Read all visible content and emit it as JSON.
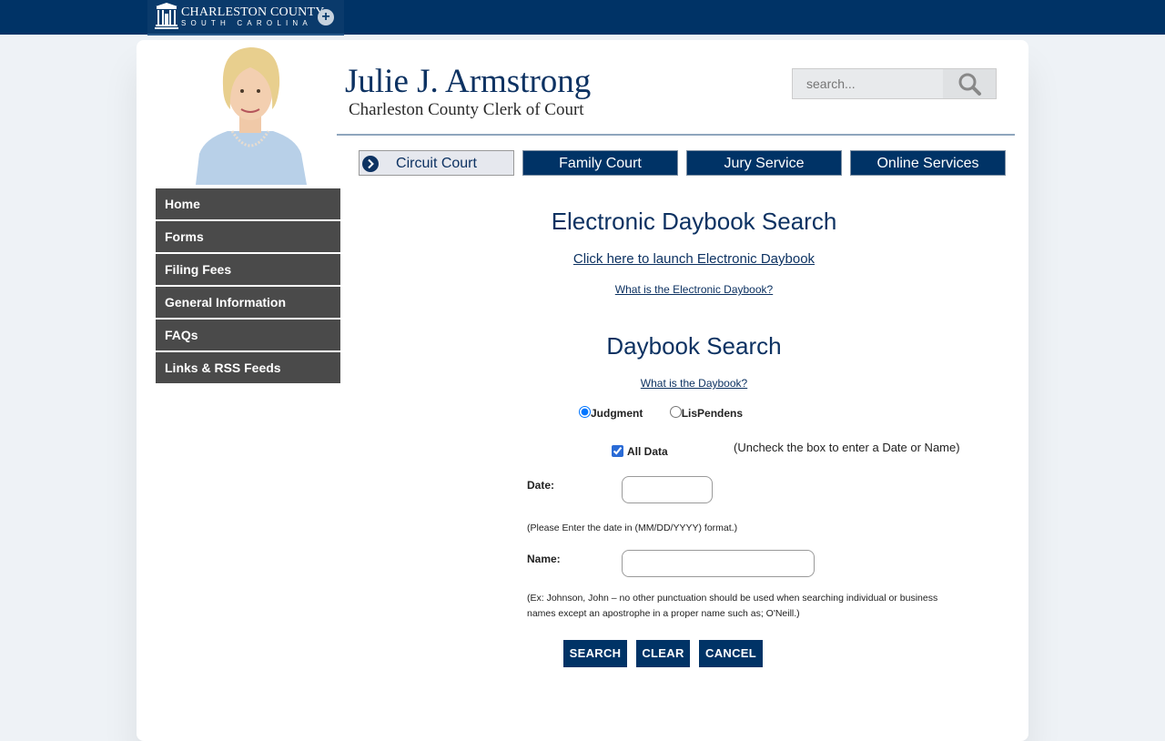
{
  "header": {
    "logo_line1": "CHARLESTON COUNTY",
    "logo_line2": "SOUTH CAROLINA",
    "logo_plus": "+"
  },
  "site": {
    "name": "Julie J. Armstrong",
    "subtitle": "Charleston County Clerk of Court"
  },
  "search": {
    "placeholder": "search..."
  },
  "topnav": [
    {
      "label": "Circuit Court",
      "active": true
    },
    {
      "label": "Family Court",
      "active": false
    },
    {
      "label": "Jury Service",
      "active": false
    },
    {
      "label": "Online Services",
      "active": false
    }
  ],
  "sidebar": {
    "items": [
      {
        "label": "Home"
      },
      {
        "label": "Forms"
      },
      {
        "label": "Filing Fees"
      },
      {
        "label": "General Information"
      },
      {
        "label": "FAQs"
      },
      {
        "label": "Links & RSS Feeds"
      }
    ]
  },
  "main": {
    "ed_heading": "Electronic Daybook Search",
    "ed_launch_link": "Click here to launch Electronic Daybook",
    "ed_what_link": "What is the Electronic Daybook?",
    "db_heading": "Daybook Search",
    "db_what_link": "What is the Daybook?",
    "radio_judgment": "Judgment",
    "radio_lispendens": "LisPendens",
    "alldata_label": "All Data",
    "alldata_hint": "(Uncheck the box to enter a Date or Name)",
    "date_label": "Date:",
    "date_value": "",
    "date_note": "(Please Enter the date in (MM/DD/YYYY) format.)",
    "name_label": "Name:",
    "name_value": "",
    "name_note": "(Ex: Johnson, John – no other punctuation should be used when searching individual or business names except an apostrophe in a proper name such as; O'Neill.)",
    "search_btn": "SEARCH",
    "clear_btn": "CLEAR",
    "cancel_btn": "CANCEL"
  },
  "colors": {
    "navy": "#003366",
    "heading": "#0d3262",
    "sidebar_bg": "#4a4a4a"
  }
}
